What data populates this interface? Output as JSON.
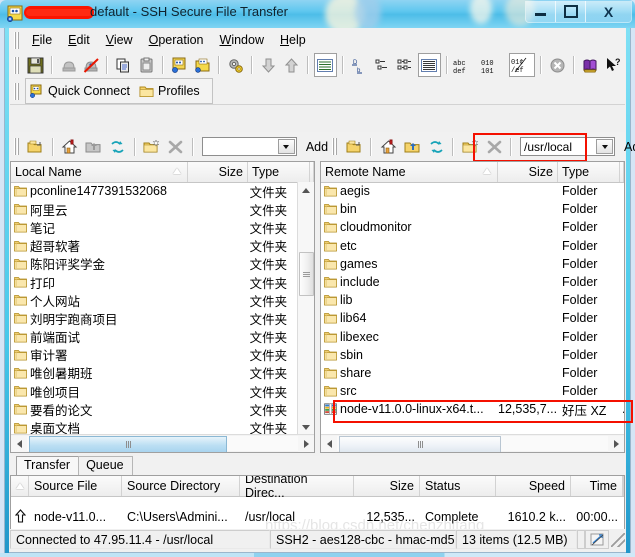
{
  "window": {
    "title_redacted_prefix": "",
    "title": "default - SSH Secure File Transfer",
    "app_icon": "ssh-file-transfer-icon",
    "minimize_label": "",
    "maximize_label": "",
    "close_label": "X"
  },
  "menu": {
    "items": [
      {
        "label": "File",
        "mnemonic": "F"
      },
      {
        "label": "Edit",
        "mnemonic": "E"
      },
      {
        "label": "View",
        "mnemonic": "V"
      },
      {
        "label": "Operation",
        "mnemonic": "O"
      },
      {
        "label": "Window",
        "mnemonic": "W"
      },
      {
        "label": "Help",
        "mnemonic": "H"
      }
    ]
  },
  "toolbar": {
    "buttons": [
      {
        "name": "save-icon"
      },
      {
        "name": "connect-icon"
      },
      {
        "name": "disconnect-icon"
      },
      {
        "name": "copy-icon"
      },
      {
        "name": "paste-icon"
      },
      {
        "name": "new-terminal-icon"
      },
      {
        "name": "new-file-transfer-icon"
      },
      {
        "name": "settings-icon"
      },
      {
        "name": "download-icon"
      },
      {
        "name": "upload-icon"
      },
      {
        "name": "list-view-icon"
      },
      {
        "name": "sort-ascending-icon"
      },
      {
        "name": "small-icons-icon"
      },
      {
        "name": "details-view-icon"
      },
      {
        "name": "detail-list-icon"
      },
      {
        "name": "ascii-transfer-icon"
      },
      {
        "name": "binary-transfer-icon"
      },
      {
        "name": "auto-transfer-icon"
      },
      {
        "name": "stop-icon"
      },
      {
        "name": "help-book-icon"
      },
      {
        "name": "context-help-icon"
      }
    ]
  },
  "quick_bar": {
    "quick_connect": "Quick Connect",
    "quick_connect_icon": "quick-connect-icon",
    "profiles": "Profiles",
    "profiles_icon": "profiles-folder-icon"
  },
  "local_path_bar": {
    "buttons": [
      {
        "name": "up-one-level-icon"
      },
      {
        "name": "home-folder-icon"
      },
      {
        "name": "go-to-folder-icon"
      },
      {
        "name": "refresh-icon"
      },
      {
        "name": "new-folder-icon"
      },
      {
        "name": "delete-icon"
      }
    ],
    "path_value": "",
    "path_placeholder": "",
    "add_label": "Add",
    "dropdown_icon": "chevron-down-icon"
  },
  "remote_path_bar": {
    "buttons": [
      {
        "name": "up-one-level-icon"
      },
      {
        "name": "home-folder-icon"
      },
      {
        "name": "go-to-folder-icon"
      },
      {
        "name": "refresh-icon"
      },
      {
        "name": "new-folder-icon"
      },
      {
        "name": "delete-icon"
      }
    ],
    "path_value": "/usr/local",
    "add_label": "Add",
    "dropdown_icon": "chevron-down-icon",
    "highlight_color": "#f41000"
  },
  "local_pane": {
    "columns": {
      "name": "Local Name",
      "size": "Size",
      "type": "Type"
    },
    "sort_indicator": "ascending",
    "rows": [
      {
        "name": "pconline1477391532068",
        "size": "",
        "type": "文件夹",
        "icon": "folder-icon"
      },
      {
        "name": "阿里云",
        "size": "",
        "type": "文件夹",
        "icon": "folder-icon"
      },
      {
        "name": "笔记",
        "size": "",
        "type": "文件夹",
        "icon": "folder-icon"
      },
      {
        "name": "超哥软著",
        "size": "",
        "type": "文件夹",
        "icon": "folder-icon"
      },
      {
        "name": "陈阳评奖学金",
        "size": "",
        "type": "文件夹",
        "icon": "folder-icon"
      },
      {
        "name": "打印",
        "size": "",
        "type": "文件夹",
        "icon": "folder-icon"
      },
      {
        "name": "个人网站",
        "size": "",
        "type": "文件夹",
        "icon": "folder-icon"
      },
      {
        "name": "刘明宇跑商项目",
        "size": "",
        "type": "文件夹",
        "icon": "folder-icon"
      },
      {
        "name": "前端面试",
        "size": "",
        "type": "文件夹",
        "icon": "folder-icon"
      },
      {
        "name": "审计署",
        "size": "",
        "type": "文件夹",
        "icon": "folder-icon"
      },
      {
        "name": "唯创暑期班",
        "size": "",
        "type": "文件夹",
        "icon": "folder-icon"
      },
      {
        "name": "唯创项目",
        "size": "",
        "type": "文件夹",
        "icon": "folder-icon"
      },
      {
        "name": "要看的论文",
        "size": "",
        "type": "文件夹",
        "icon": "folder-icon"
      },
      {
        "name": "桌面文档",
        "size": "",
        "type": "文件夹",
        "icon": "folder-icon"
      }
    ]
  },
  "remote_pane": {
    "columns": {
      "name": "Remote Name",
      "size": "Size",
      "type": "Type"
    },
    "sort_indicator": "ascending",
    "rows": [
      {
        "name": "aegis",
        "size": "",
        "type": "Folder",
        "extra": "",
        "icon": "folder-icon",
        "selected": false
      },
      {
        "name": "bin",
        "size": "",
        "type": "Folder",
        "extra": "",
        "icon": "folder-icon",
        "selected": false
      },
      {
        "name": "cloudmonitor",
        "size": "",
        "type": "Folder",
        "extra": "",
        "icon": "folder-icon",
        "selected": false
      },
      {
        "name": "etc",
        "size": "",
        "type": "Folder",
        "extra": "",
        "icon": "folder-icon",
        "selected": false
      },
      {
        "name": "games",
        "size": "",
        "type": "Folder",
        "extra": "",
        "icon": "folder-icon",
        "selected": false
      },
      {
        "name": "include",
        "size": "",
        "type": "Folder",
        "extra": "",
        "icon": "folder-icon",
        "selected": false
      },
      {
        "name": "lib",
        "size": "",
        "type": "Folder",
        "extra": "",
        "icon": "folder-icon",
        "selected": false
      },
      {
        "name": "lib64",
        "size": "",
        "type": "Folder",
        "extra": "",
        "icon": "folder-icon",
        "selected": false
      },
      {
        "name": "libexec",
        "size": "",
        "type": "Folder",
        "extra": "",
        "icon": "folder-icon",
        "selected": false
      },
      {
        "name": "sbin",
        "size": "",
        "type": "Folder",
        "extra": "",
        "icon": "folder-icon",
        "selected": false
      },
      {
        "name": "share",
        "size": "",
        "type": "Folder",
        "extra": "",
        "icon": "folder-icon",
        "selected": false
      },
      {
        "name": "src",
        "size": "",
        "type": "Folder",
        "extra": "",
        "icon": "folder-icon",
        "selected": false
      },
      {
        "name": "node-v11.0.0-linux-x64.t...",
        "size": "12,535,7...",
        "type": "好压 XZ",
        "extra": "...",
        "icon": "archive-icon",
        "selected": true
      }
    ]
  },
  "transfer_panel": {
    "tabs": [
      {
        "label": "Transfer",
        "active": true
      },
      {
        "label": "Queue",
        "active": false
      }
    ],
    "columns": [
      "Source File",
      "Source Directory",
      "Destination Direc...",
      "Size",
      "Status",
      "Speed",
      "Time"
    ],
    "sort_indicator": "ascending",
    "rows": [
      {
        "direction_icon": "upload-arrow-icon",
        "source_file": "node-v11.0...",
        "source_directory": "C:\\Users\\Admini...",
        "destination_directory": "/usr/local",
        "size": "12,535...",
        "status": "Complete",
        "speed": "1610.2 k...",
        "time": "00:00..."
      }
    ]
  },
  "status_bar": {
    "connection": "Connected to 47.95.11.4 - /usr/local",
    "cipher": "SSH2 - aes128-cbc - hmac-md5",
    "items": "13 items (12.5 MB)",
    "indicator_icon": "transfer-activity-icon"
  },
  "watermark": "https://blog.csdn.net/chenzhifang"
}
